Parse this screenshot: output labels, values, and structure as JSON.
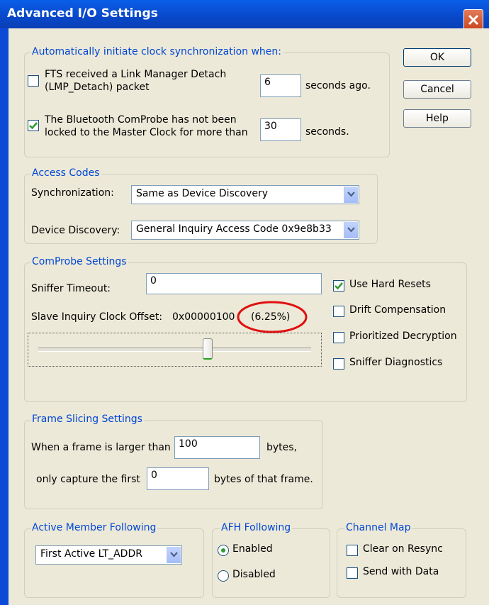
{
  "window": {
    "title": "Advanced I/O Settings"
  },
  "buttons": {
    "ok": "OK",
    "cancel": "Cancel",
    "help": "Help"
  },
  "clock_sync": {
    "legend": "Automatically initiate clock synchronization when:",
    "fts": {
      "checked": false,
      "label_line1": "FTS received a Link Manager Detach",
      "label_line2": "(LMP_Detach) packet",
      "value": "6",
      "suffix": "seconds ago."
    },
    "bluetooth": {
      "checked": true,
      "label_line1": "The Bluetooth ComProbe has not been",
      "label_line2": "locked to the Master Clock for more than",
      "value": "30",
      "suffix": "seconds."
    }
  },
  "access_codes": {
    "legend": "Access Codes",
    "sync_label": "Synchronization:",
    "sync_value": "Same as Device Discovery",
    "discovery_label": "Device Discovery:",
    "discovery_value": "General Inquiry Access Code 0x9e8b33"
  },
  "comprobe": {
    "legend": "ComProbe Settings",
    "sniffer_timeout_label": "Sniffer Timeout:",
    "sniffer_timeout_value": "0",
    "slave_offset_label": "Slave Inquiry Clock Offset:",
    "slave_offset_value": "0x00000100",
    "slave_offset_pct": "(6.25%)",
    "slider_level": 0.62,
    "checkboxes": [
      {
        "label": "Use Hard Resets",
        "checked": true
      },
      {
        "label": "Drift Compensation",
        "checked": false
      },
      {
        "label": "Prioritized Decryption",
        "checked": false
      },
      {
        "label": "Sniffer Diagnostics",
        "checked": false
      }
    ]
  },
  "frame_slicing": {
    "legend": "Frame Slicing Settings",
    "larger_label": "When a frame is larger than",
    "larger_value": "100",
    "bytes_label": "bytes,",
    "capture_label": "only capture the first",
    "capture_value": "0",
    "bytes_frame_label": "bytes of that frame."
  },
  "active_member": {
    "legend": "Active Member Following",
    "value": "First Active LT_ADDR"
  },
  "afh": {
    "legend": "AFH Following",
    "enabled_label": "Enabled",
    "disabled_label": "Disabled",
    "selected": "Enabled"
  },
  "channel_map": {
    "legend": "Channel Map",
    "clear_label": "Clear on Resync",
    "clear_checked": false,
    "send_label": "Send with Data",
    "send_checked": false
  },
  "colors": {
    "title_blue": "#0a5ee8",
    "legend_blue": "#0046d5",
    "highlight_red": "#e01010",
    "check_green": "#2f9a2f"
  }
}
